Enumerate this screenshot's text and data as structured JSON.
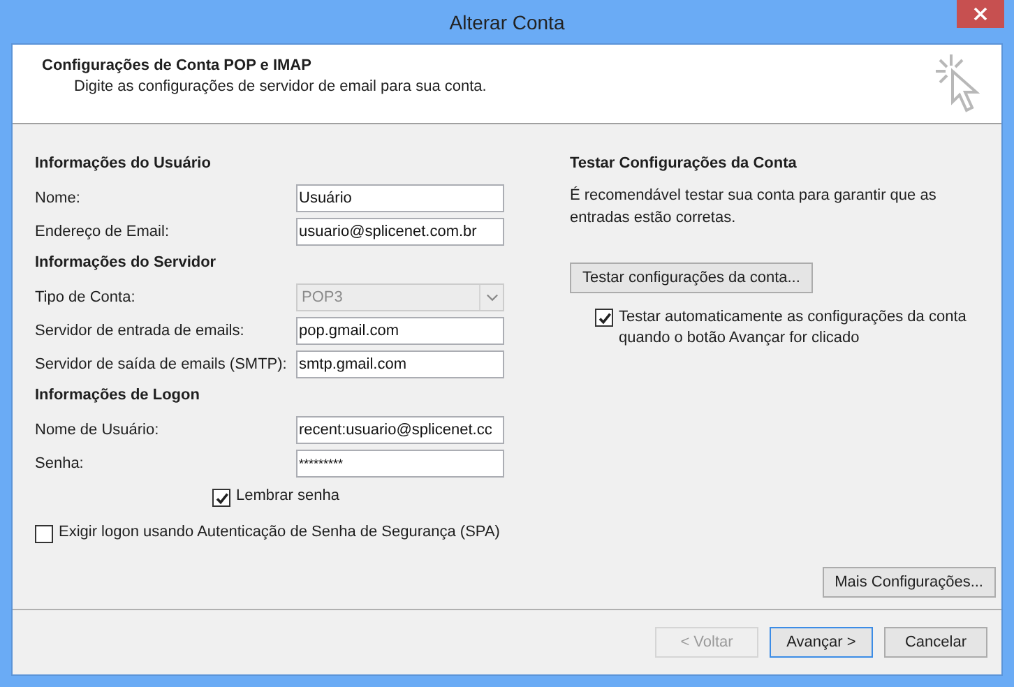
{
  "window": {
    "title": "Alterar Conta"
  },
  "header": {
    "title": "Configurações de Conta POP e IMAP",
    "subtitle": "Digite as configurações de servidor de email para sua conta."
  },
  "left_sections": [
    {
      "heading": "Informações do Usuário",
      "fields": [
        {
          "label": "Nome:",
          "kind": "text",
          "value": "Usuário",
          "disabled": false
        },
        {
          "label": "Endereço de Email:",
          "kind": "text",
          "value": "usuario@splicenet.com.br",
          "disabled": false
        }
      ]
    },
    {
      "heading": "Informações do Servidor",
      "fields": [
        {
          "label": "Tipo de Conta:",
          "kind": "select",
          "value": "POP3",
          "disabled": true
        },
        {
          "label": "Servidor de entrada de emails:",
          "kind": "text",
          "value": "pop.gmail.com",
          "disabled": false
        },
        {
          "label": "Servidor de saída de emails (SMTP):",
          "kind": "text",
          "value": "smtp.gmail.com",
          "disabled": false
        }
      ]
    },
    {
      "heading": "Informações de Logon",
      "fields": [
        {
          "label": "Nome de Usuário:",
          "kind": "text",
          "value": "recent:usuario@splicenet.cc",
          "disabled": false
        },
        {
          "label": "Senha:",
          "kind": "password",
          "value": "*********",
          "disabled": false
        }
      ]
    }
  ],
  "remember_password": {
    "label": "Lembrar senha",
    "checked": true
  },
  "spa": {
    "label": "Exigir logon usando Autenticação de Senha de Segurança (SPA)",
    "checked": false
  },
  "test_section": {
    "heading": "Testar Configurações da Conta",
    "description": "É recomendável testar sua conta para garantir que as entradas estão corretas.",
    "button": "Testar configurações da conta...",
    "auto_test": {
      "label": "Testar automaticamente as configurações da conta quando o botão Avançar for clicado",
      "checked": true
    }
  },
  "more_button": "Mais Configurações...",
  "footer_buttons": [
    {
      "label": "< Voltar",
      "disabled": true,
      "default": false
    },
    {
      "label": "Avançar >",
      "disabled": false,
      "default": true
    },
    {
      "label": "Cancelar",
      "disabled": false,
      "default": false
    }
  ]
}
